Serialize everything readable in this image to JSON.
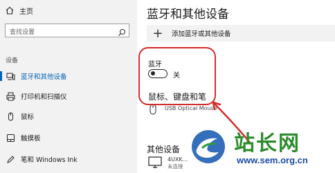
{
  "sidebar": {
    "home_label": "主页",
    "search_placeholder": "查找设置",
    "section_heading": "设备",
    "items": [
      {
        "label": "蓝牙和其他设备",
        "icon": "bluetooth-devices-icon",
        "active": true
      },
      {
        "label": "打印机和扫描仪",
        "icon": "printer-icon",
        "active": false
      },
      {
        "label": "鼠标",
        "icon": "mouse-icon",
        "active": false
      },
      {
        "label": "触摸板",
        "icon": "touchpad-icon",
        "active": false
      },
      {
        "label": "笔和 Windows Ink",
        "icon": "pen-icon",
        "active": false
      }
    ]
  },
  "main": {
    "title": "蓝牙和其他设备",
    "add_device_label": "添加蓝牙或其他设备",
    "bluetooth_label": "蓝牙",
    "bluetooth_state": "关",
    "mouse_section_heading": "鼠标、键盘和笔",
    "mouse_device_name": "USB Optical Mouse",
    "other_section_heading": "其他设备",
    "other_device_name": "4UXK...",
    "other_device_status": "未连接"
  },
  "watermark": {
    "text": "站长网",
    "url": "www.sem.org.cn"
  },
  "colors": {
    "accent": "#0063b1",
    "highlight_red": "#d62a2a",
    "sidebar_bg": "#f2f2f2",
    "watermark_green": "#2e8b2e",
    "watermark_blue": "#1a4aa8"
  }
}
